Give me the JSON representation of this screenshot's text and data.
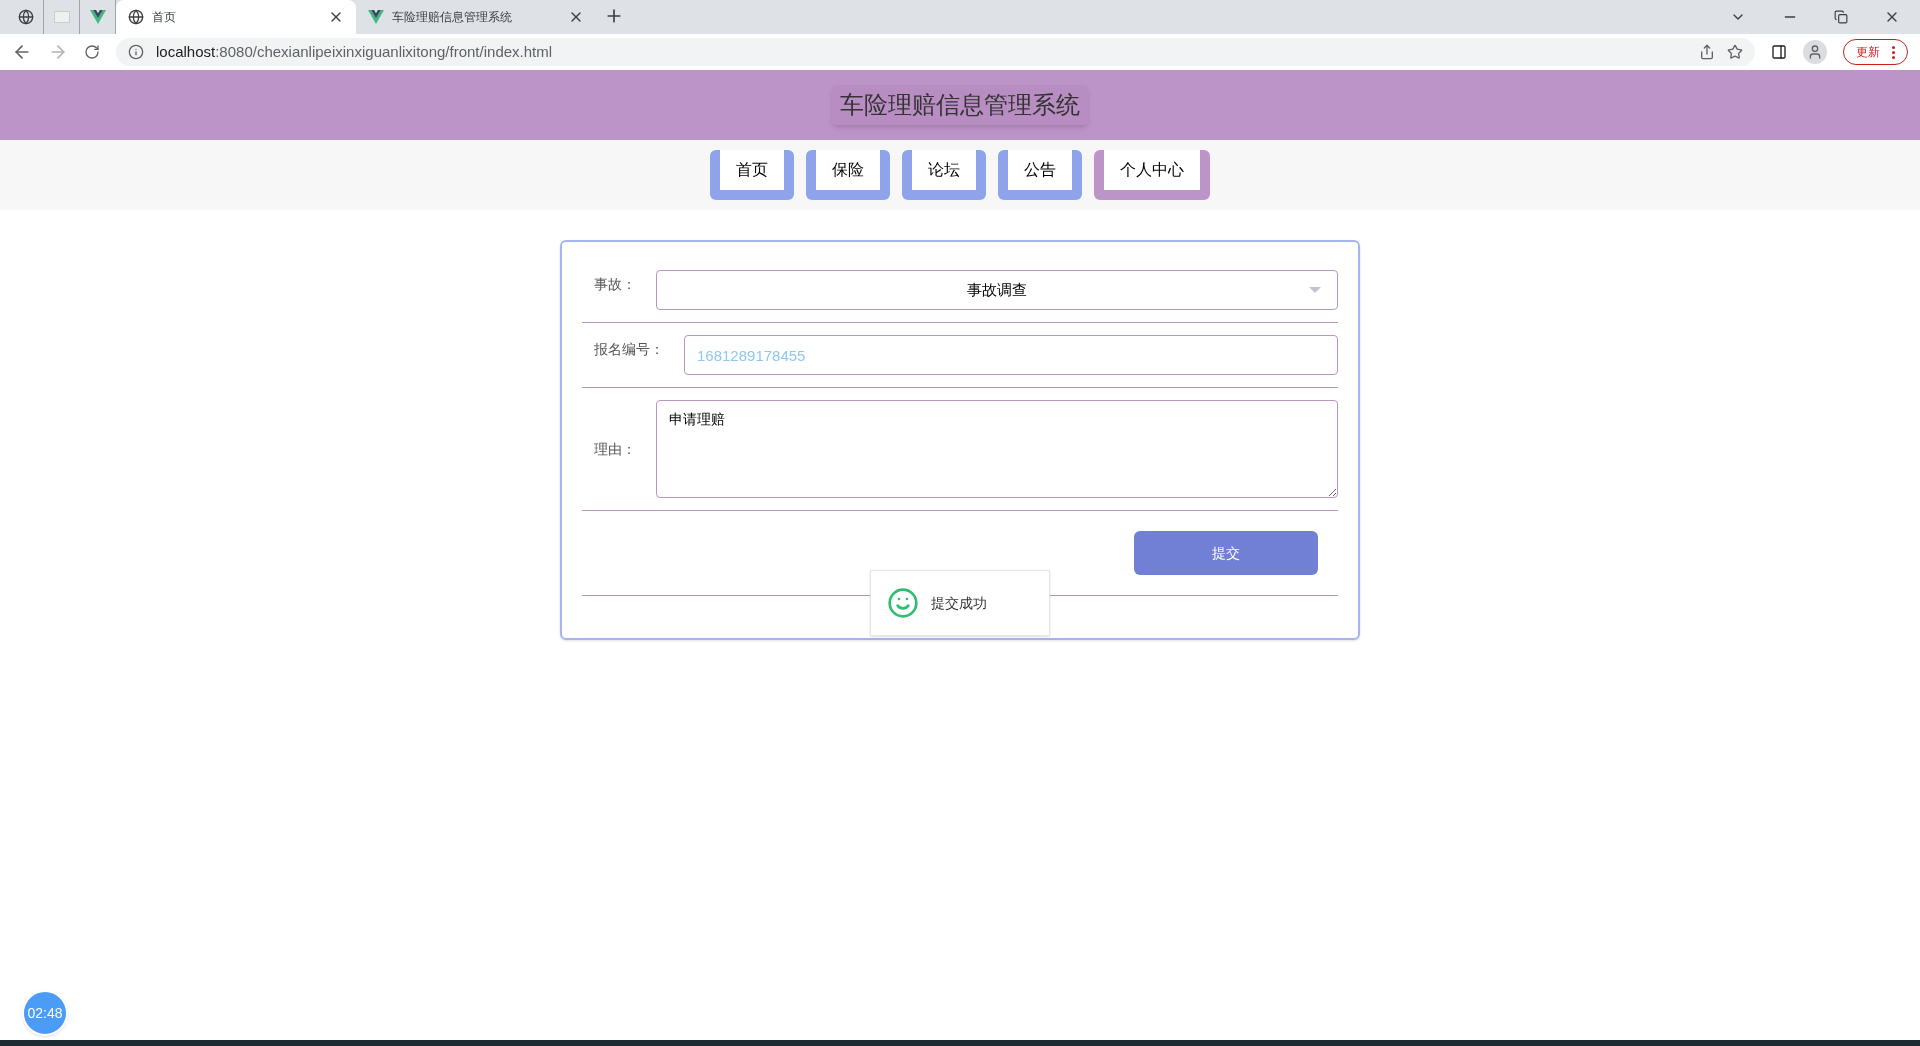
{
  "browser": {
    "tabs": [
      {
        "kind": "pinned",
        "selected": false
      },
      {
        "kind": "pinned",
        "selected": false
      },
      {
        "kind": "pinned",
        "selected": false
      },
      {
        "kind": "full",
        "title": "首页",
        "selected": true
      },
      {
        "kind": "full",
        "title": "车险理赔信息管理系统",
        "selected": false
      }
    ],
    "url_host": "localhost",
    "url_rest": ":8080/chexianlipeixinxiguanlixitong/front/index.html",
    "update_button": "更新"
  },
  "header": {
    "title": "车险理赔信息管理系统"
  },
  "nav": [
    {
      "label": "首页",
      "selected": false
    },
    {
      "label": "保险",
      "selected": false
    },
    {
      "label": "论坛",
      "selected": false
    },
    {
      "label": "公告",
      "selected": false
    },
    {
      "label": "个人中心",
      "selected": true
    }
  ],
  "form": {
    "fields": [
      {
        "kind": "select",
        "label": "事故：",
        "value": "事故调查"
      },
      {
        "kind": "input",
        "label": "报名编号：",
        "placeholder": "1681289178455"
      },
      {
        "kind": "textarea",
        "label": "理由：",
        "value": "申请理赔"
      }
    ],
    "submit": "提交"
  },
  "toast": {
    "message": "提交成功"
  },
  "timer": "02:48"
}
